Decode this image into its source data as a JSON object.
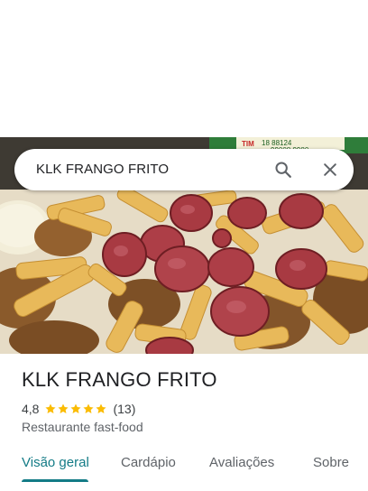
{
  "search": {
    "query": "KLK FRANGO FRITO",
    "search_icon": "search-icon",
    "close_icon": "close-icon"
  },
  "photo": {
    "sign_text_1": "TIM",
    "sign_text_2": "18 88124",
    "sign_text_3": "99008 9980"
  },
  "place": {
    "name": "KLK FRANGO FRITO",
    "rating": "4,8",
    "stars": 5,
    "reviews": "(13)",
    "category": "Restaurante fast-food"
  },
  "tabs": {
    "overview": "Visão geral",
    "menu": "Cardápio",
    "reviews": "Avaliações",
    "about": "Sobre"
  },
  "colors": {
    "accent": "#137b86",
    "star": "#fbbc04"
  }
}
